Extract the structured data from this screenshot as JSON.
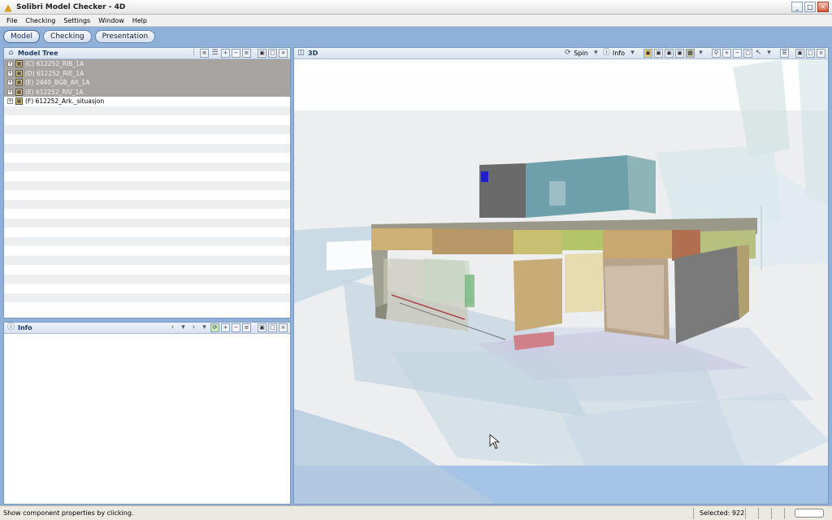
{
  "window": {
    "title": "Solibri Model Checker - 4D"
  },
  "menu": [
    "File",
    "Checking",
    "Settings",
    "Window",
    "Help"
  ],
  "perspectives": [
    "Model",
    "Checking",
    "Presentation"
  ],
  "model_tree": {
    "title": "Model Tree",
    "items": [
      {
        "label": "(C) 612252_RIB_1A",
        "selected": true
      },
      {
        "label": "(D) 612252_RIE_1A",
        "selected": true
      },
      {
        "label": "(E) 2440_BGB_Alt_1A",
        "selected": true
      },
      {
        "label": "(E) 612252_RIV_1A",
        "selected": true
      },
      {
        "label": "(F) 612252_Ark._situasjon",
        "selected": false
      }
    ]
  },
  "info_panel": {
    "title": "Info"
  },
  "view3d": {
    "title": "3D",
    "spin_label": "Spin",
    "info_label": "Info"
  },
  "status": {
    "hint": "Show component properties by clicking.",
    "selected": "Selected: 922"
  },
  "colors": {
    "accent": "#8fb0d8",
    "selection": "#a6a3a0",
    "sky": "#eef0f2",
    "ground": "#c8dce8"
  }
}
